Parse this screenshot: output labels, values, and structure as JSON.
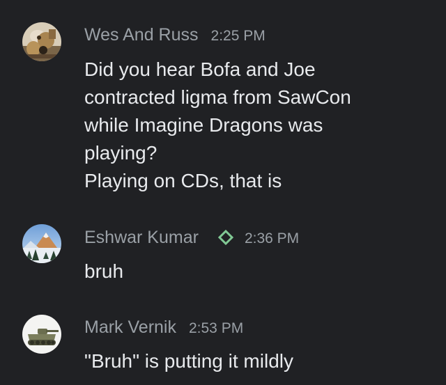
{
  "messages": [
    {
      "avatar": "avatar-wes-and-russ",
      "name": "Wes And Russ",
      "time": "2:25 PM",
      "lines": [
        "Did you hear Bofa and Joe",
        "contracted ligma from SawCon",
        "while Imagine Dragons was",
        "playing?",
        "Playing on CDs, that is"
      ]
    },
    {
      "avatar": "avatar-eshwar-kumar",
      "name": "Eshwar Kumar",
      "badge_icon": "diamond-outline-icon",
      "badge_color": "#81c995",
      "time": "2:36 PM",
      "lines": [
        "bruh"
      ]
    },
    {
      "avatar": "avatar-mark-vernik",
      "name": "Mark Vernik",
      "time": "2:53 PM",
      "lines": [
        "\"Bruh\" is putting it mildly"
      ]
    }
  ],
  "colors": {
    "background": "#202124",
    "name_time_text": "#9aa0a6",
    "message_text": "#e8eaed"
  }
}
